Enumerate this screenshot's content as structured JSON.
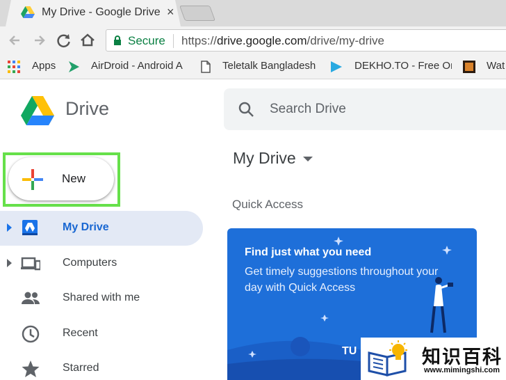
{
  "browser": {
    "tab_title": "My Drive - Google Drive",
    "tab_close": "×",
    "secure_label": "Secure",
    "url_scheme": "https://",
    "url_host": "drive.google.com",
    "url_path": "/drive/my-drive"
  },
  "bookmarks": [
    {
      "label": "Apps",
      "icon": "apps-grid-icon"
    },
    {
      "label": "AirDroid - Android A",
      "icon": "airdroid-icon"
    },
    {
      "label": "Teletalk Bangladesh",
      "icon": "page-icon"
    },
    {
      "label": "DEKHO.TO - Free On",
      "icon": "dekho-icon"
    },
    {
      "label": "Wat",
      "icon": "film-icon"
    }
  ],
  "drive": {
    "app_name": "Drive",
    "search_placeholder": "Search Drive",
    "new_label": "New"
  },
  "sidebar": {
    "items": [
      {
        "label": "My Drive",
        "icon": "my-drive-icon",
        "active": true
      },
      {
        "label": "Computers",
        "icon": "computers-icon"
      },
      {
        "label": "Shared with me",
        "icon": "shared-people-icon"
      },
      {
        "label": "Recent",
        "icon": "clock-icon"
      },
      {
        "label": "Starred",
        "icon": "star-icon"
      }
    ]
  },
  "main": {
    "title": "My Drive",
    "quick_access_label": "Quick Access",
    "card": {
      "title": "Find just what you need",
      "body": "Get timely suggestions throughout your day with Quick Access",
      "cta": "TU"
    }
  },
  "watermark": {
    "chinese": "知识百科",
    "url": "www.mimingshi.com"
  },
  "colors": {
    "accent": "#1a73e8",
    "secure_green": "#0b8043",
    "highlight_green": "#66e04a",
    "card_blue": "#1e6fd9"
  }
}
